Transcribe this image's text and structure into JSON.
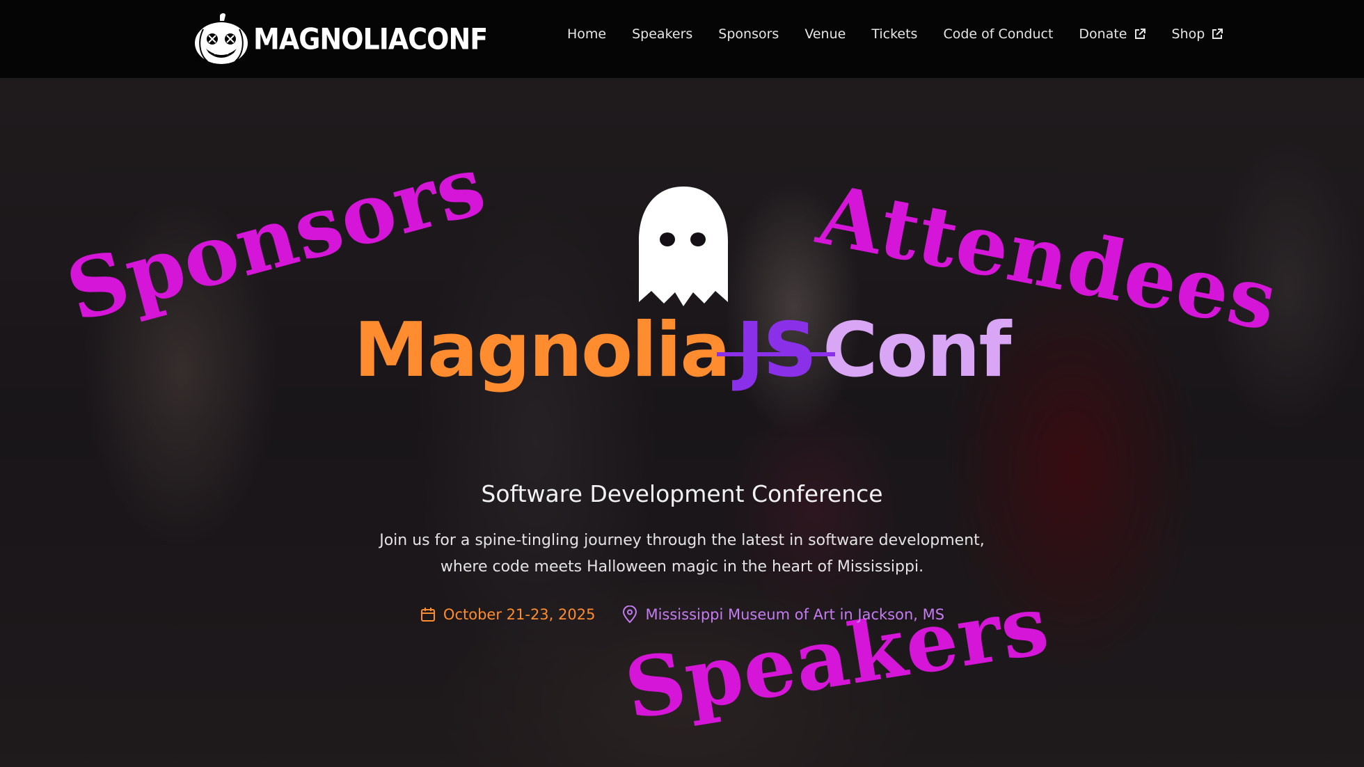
{
  "nav": {
    "logo_text": "MAGNOLIACONF",
    "items": [
      {
        "label": "Home",
        "external": false
      },
      {
        "label": "Speakers",
        "external": false
      },
      {
        "label": "Sponsors",
        "external": false
      },
      {
        "label": "Venue",
        "external": false
      },
      {
        "label": "Tickets",
        "external": false
      },
      {
        "label": "Code of Conduct",
        "external": false
      },
      {
        "label": "Donate",
        "external": true
      },
      {
        "label": "Shop",
        "external": true
      }
    ]
  },
  "hero": {
    "overlay_words": [
      "Sponsors",
      "Attendees",
      "Speakers"
    ],
    "title": {
      "part1": "Magnolia",
      "part2": "JS",
      "part3": "Conf"
    },
    "subtitle": "Software Development Conference",
    "description": "Join us for a spine-tingling journey through the latest in software development, where code meets Halloween magic in the heart of Mississippi.",
    "date": "October 21-23, 2025",
    "location": "Mississippi Museum of Art in Jackson, MS"
  },
  "colors": {
    "orange": "#ff8c2f",
    "purple": "#8a30e8",
    "lavender": "#d9a6f6",
    "magenta": "#d516d8"
  },
  "icons": [
    "pumpkin-logo-icon",
    "ghost-icon",
    "external-link-icon",
    "calendar-icon",
    "map-pin-icon"
  ]
}
